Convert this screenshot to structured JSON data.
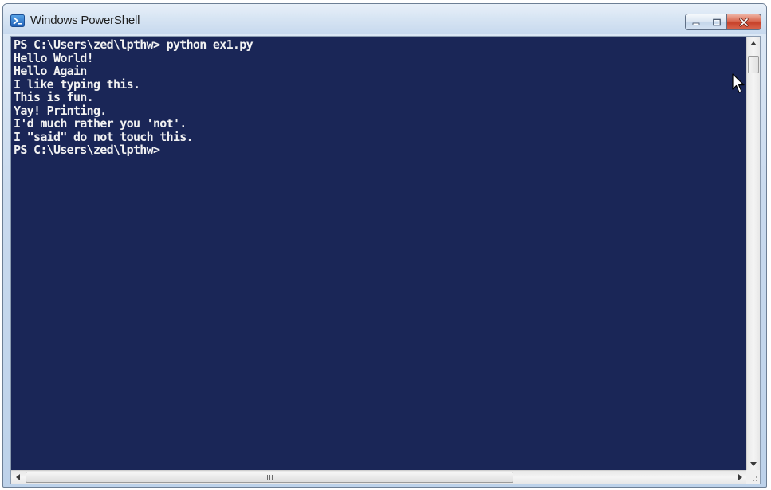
{
  "window": {
    "title": "Windows PowerShell",
    "icon": "powershell-icon"
  },
  "controls": {
    "minimize_icon": "minimize-icon",
    "maximize_icon": "maximize-icon",
    "close_icon": "close-icon"
  },
  "console": {
    "background": "#1a2657",
    "foreground": "#f2f2f2",
    "lines": [
      "PS C:\\Users\\zed\\lpthw> python ex1.py",
      "Hello World!",
      "Hello Again",
      "I like typing this.",
      "This is fun.",
      "Yay! Printing.",
      "I'd much rather you 'not'.",
      "I \"said\" do not touch this.",
      "PS C:\\Users\\zed\\lpthw>"
    ]
  },
  "scrollbars": {
    "vertical_thumb_fraction": 0.0,
    "horizontal_thumb_fraction": 0.0
  }
}
